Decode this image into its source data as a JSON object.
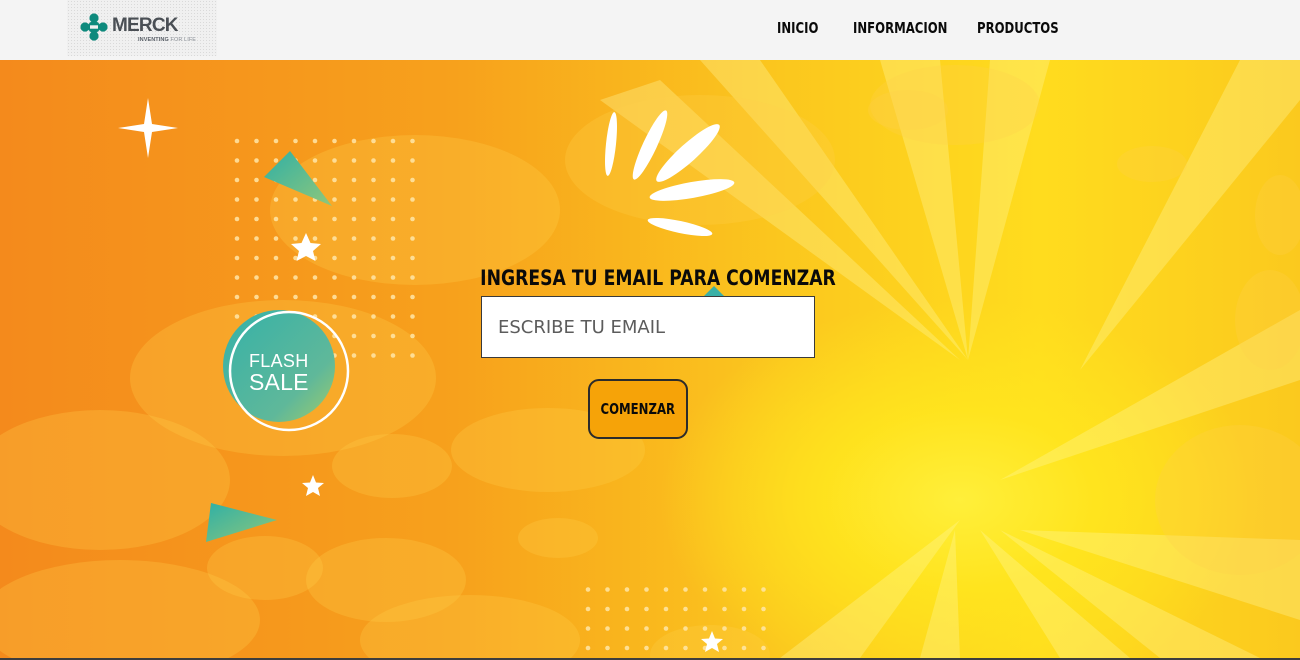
{
  "header": {
    "logo": {
      "brand": "MERCK",
      "tagline_bold": "INVENTING",
      "tagline_light": "FOR LIFE"
    },
    "nav": [
      {
        "label": "INICIO"
      },
      {
        "label": "INFORMACION"
      },
      {
        "label": "PRODUCTOS"
      }
    ]
  },
  "hero": {
    "badge": {
      "line1": "FLASH",
      "line2": "SALE"
    },
    "signup": {
      "title": "INGRESA TU EMAIL PARA COMENZAR",
      "email_placeholder": "ESCRIBE TU EMAIL",
      "email_value": "",
      "button_label": "COMENZAR"
    }
  },
  "colors": {
    "button": "#f6a308",
    "hero_orange": "#f48a1c",
    "hero_yellow": "#ffdc1e",
    "badge_teal": "#3bb3a6"
  }
}
